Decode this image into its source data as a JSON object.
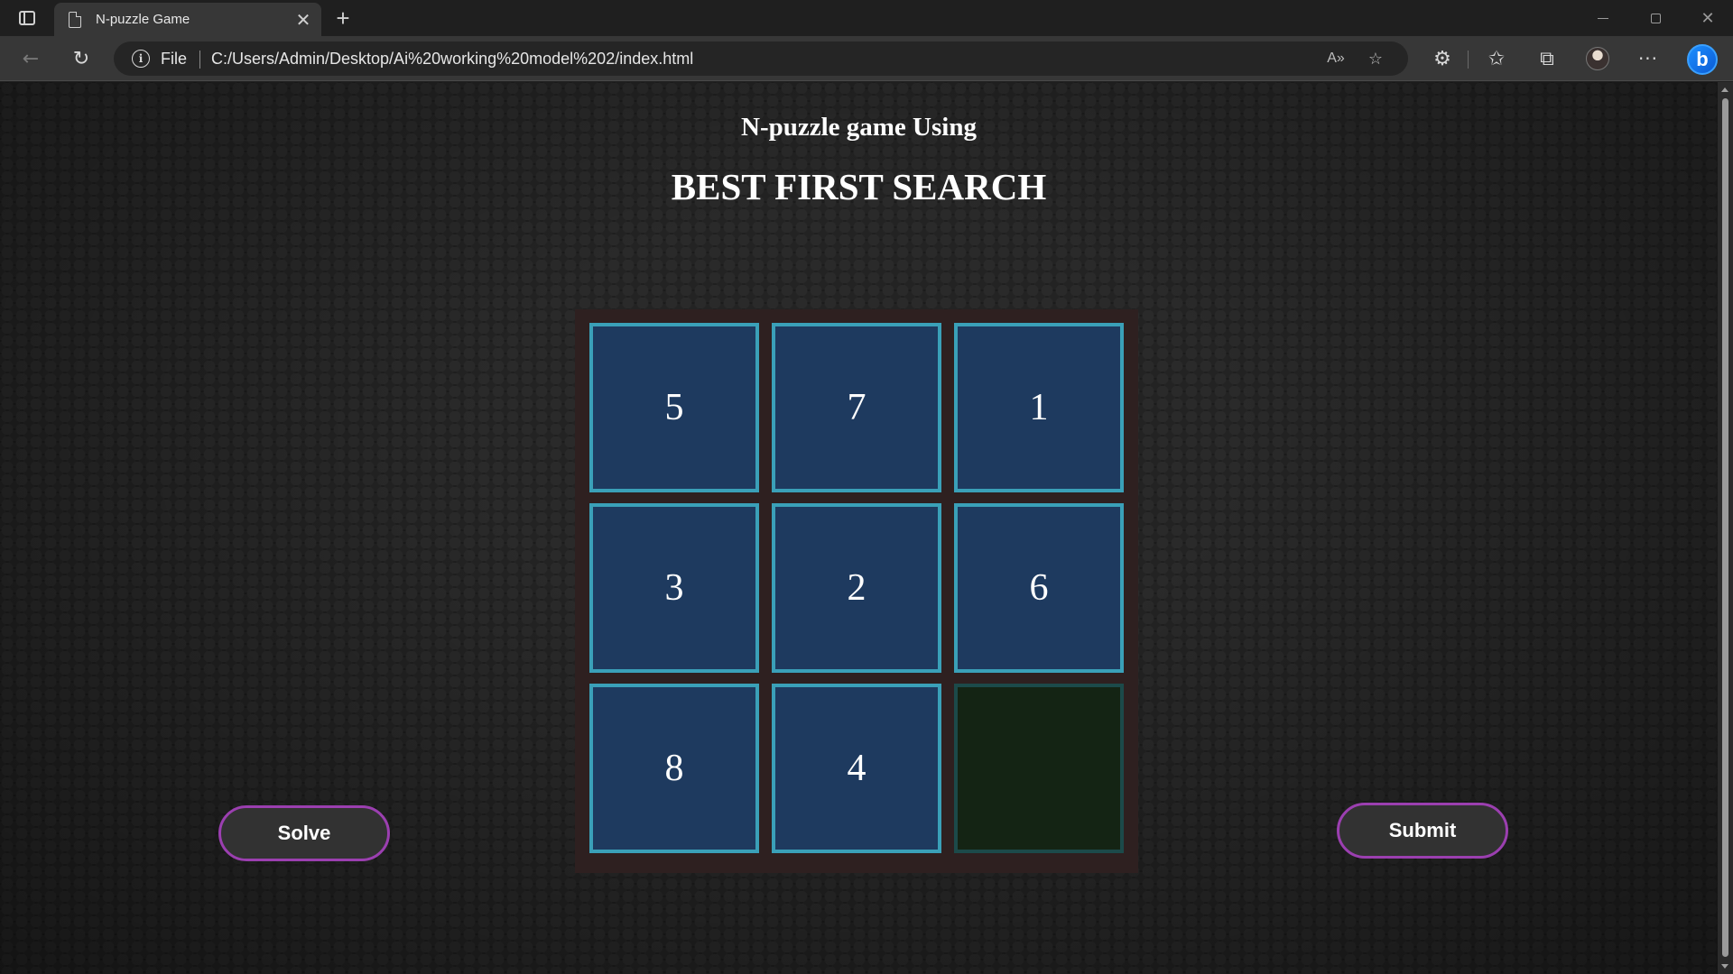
{
  "browser": {
    "tab_title": "N-puzzle Game",
    "new_tab_label": "+",
    "file_label": "File",
    "url": "C:/Users/Admin/Desktop/Ai%20working%20model%202/index.html",
    "read_aloud_label": "A»"
  },
  "page": {
    "heading_line1": "N-puzzle game Using",
    "heading_line2": "BEST FIRST SEARCH",
    "tiles": [
      "5",
      "7",
      "1",
      "3",
      "2",
      "6",
      "8",
      "4",
      ""
    ],
    "empty_tile_index": 8,
    "solve_label": "Solve",
    "submit_label": "Submit"
  },
  "colors": {
    "tile_fill": "#1e3a5f",
    "tile_border": "#3aa0b8",
    "empty_tile_fill": "#142414",
    "board_background": "#2e2020",
    "button_border": "#9b3fb0"
  },
  "icons": {
    "tab_actions": "tab-actions-icon",
    "page": "page-icon",
    "close": "close-icon",
    "back": "back-arrow-icon",
    "reload": "reload-icon",
    "info": "info-icon",
    "favorite_add": "star-plus-icon",
    "extensions": "puzzle-piece-icon",
    "favorites": "favorites-icon",
    "collections": "collections-icon",
    "profile": "profile-avatar",
    "more": "ellipsis-icon",
    "bing": "bing-copilot-icon"
  }
}
